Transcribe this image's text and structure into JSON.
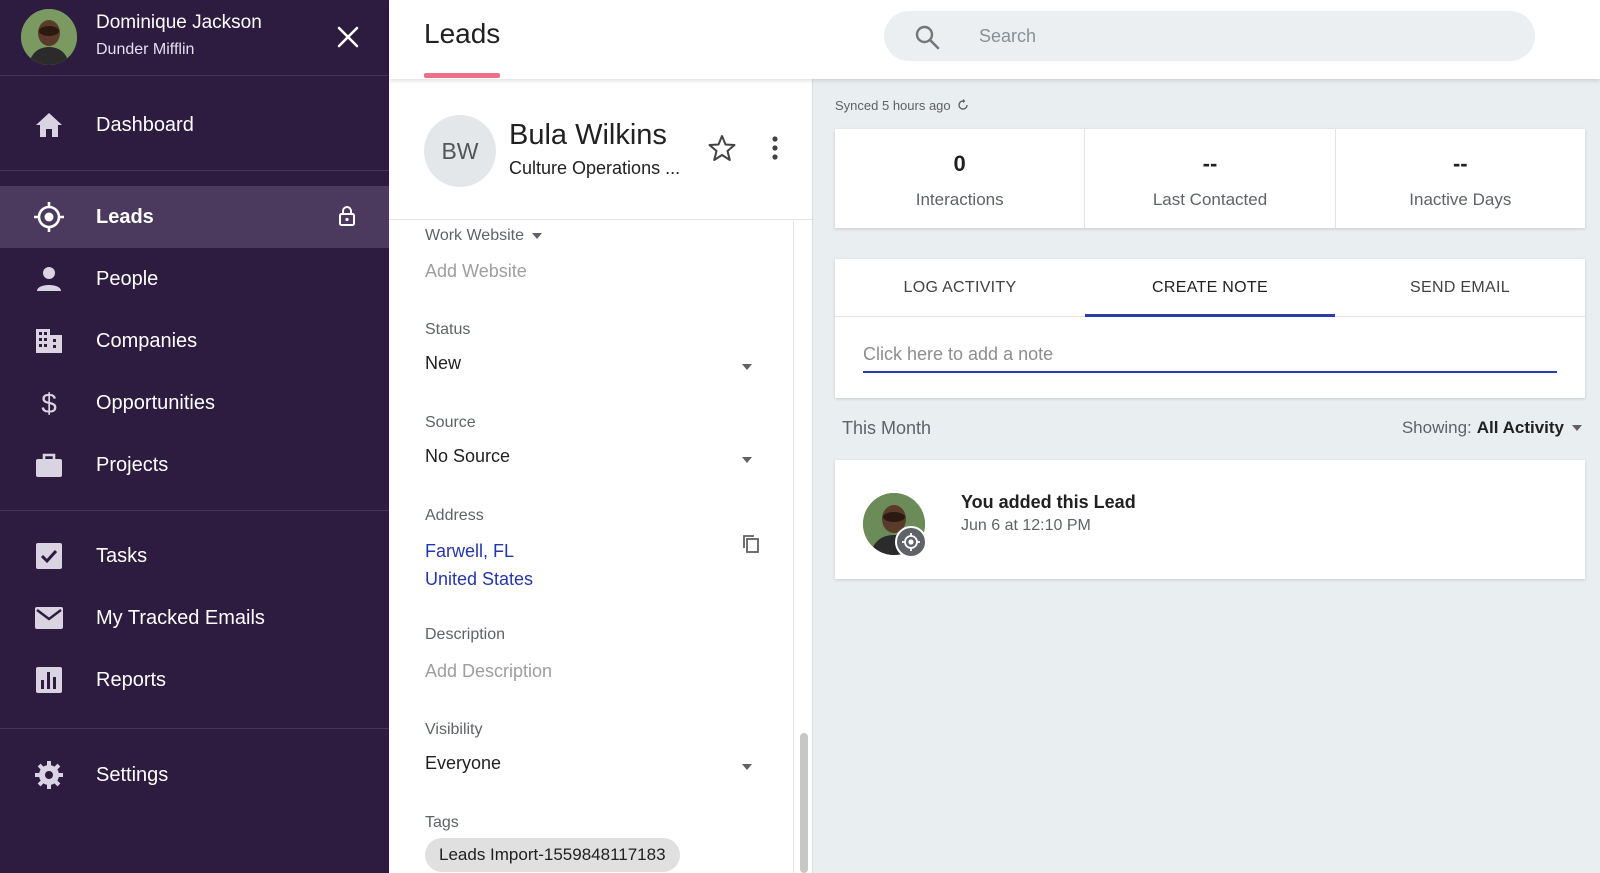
{
  "user": {
    "name": "Dominique Jackson",
    "org": "Dunder Mifflin"
  },
  "nav": {
    "dashboard": "Dashboard",
    "leads": "Leads",
    "people": "People",
    "companies": "Companies",
    "opportunities": "Opportunities",
    "projects": "Projects",
    "tasks": "Tasks",
    "tracked_emails": "My Tracked Emails",
    "reports": "Reports",
    "settings": "Settings"
  },
  "header": {
    "title": "Leads",
    "search_placeholder": "Search"
  },
  "lead": {
    "initials": "BW",
    "name": "Bula Wilkins",
    "title": "Culture Operations ..."
  },
  "fields": {
    "work_website_label": "Work Website",
    "work_website_placeholder": "Add Website",
    "status_label": "Status",
    "status_value": "New",
    "source_label": "Source",
    "source_value": "No Source",
    "address_label": "Address",
    "address_line1": "Farwell, FL",
    "address_line2": "United States",
    "description_label": "Description",
    "description_placeholder": "Add Description",
    "visibility_label": "Visibility",
    "visibility_value": "Everyone",
    "tags_label": "Tags",
    "tag_1": "Leads Import-1559848117183"
  },
  "sync": {
    "text": "Synced 5 hours ago"
  },
  "stats": {
    "interactions_value": "0",
    "interactions_label": "Interactions",
    "last_contacted_value": "--",
    "last_contacted_label": "Last Contacted",
    "inactive_value": "--",
    "inactive_label": "Inactive Days"
  },
  "tabs": {
    "log_activity": "LOG ACTIVITY",
    "create_note": "CREATE NOTE",
    "send_email": "SEND EMAIL"
  },
  "note": {
    "placeholder": "Click here to add a note"
  },
  "timeline": {
    "period": "This Month",
    "showing_label": "Showing:",
    "showing_value": "All Activity",
    "activity_title": "You added this Lead",
    "activity_time": "Jun 6 at 12:10 PM"
  },
  "colors": {
    "sidebar_bg": "#2d1b40",
    "sidebar_active": "#4b3a5e",
    "accent_pink": "#ef6f86",
    "accent_blue": "#2a3bb0",
    "link_blue": "#2536a8"
  }
}
